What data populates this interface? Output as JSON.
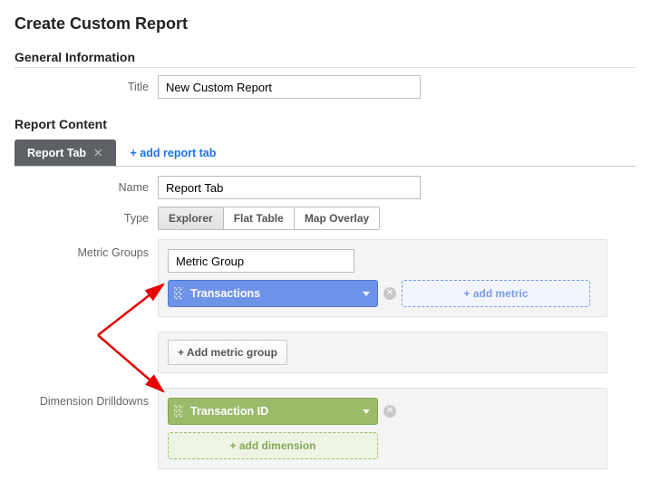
{
  "page_title": "Create Custom Report",
  "sections": {
    "general_info": "General Information",
    "report_content": "Report Content"
  },
  "general": {
    "title_label": "Title",
    "title_value": "New Custom Report"
  },
  "tabs": {
    "active_tab": "Report Tab",
    "add_tab": "+ add report tab"
  },
  "content": {
    "name_label": "Name",
    "name_value": "Report Tab",
    "type_label": "Type",
    "type_options": {
      "explorer": "Explorer",
      "flat_table": "Flat Table",
      "map_overlay": "Map Overlay"
    },
    "metric_groups_label": "Metric Groups",
    "metric_group_name": "Metric Group",
    "metric_pill": "Transactions",
    "add_metric": "+ add metric",
    "add_metric_group": "+ Add metric group",
    "dimension_label": "Dimension Drilldowns",
    "dimension_pill": "Transaction ID",
    "add_dimension": "+ add dimension"
  }
}
